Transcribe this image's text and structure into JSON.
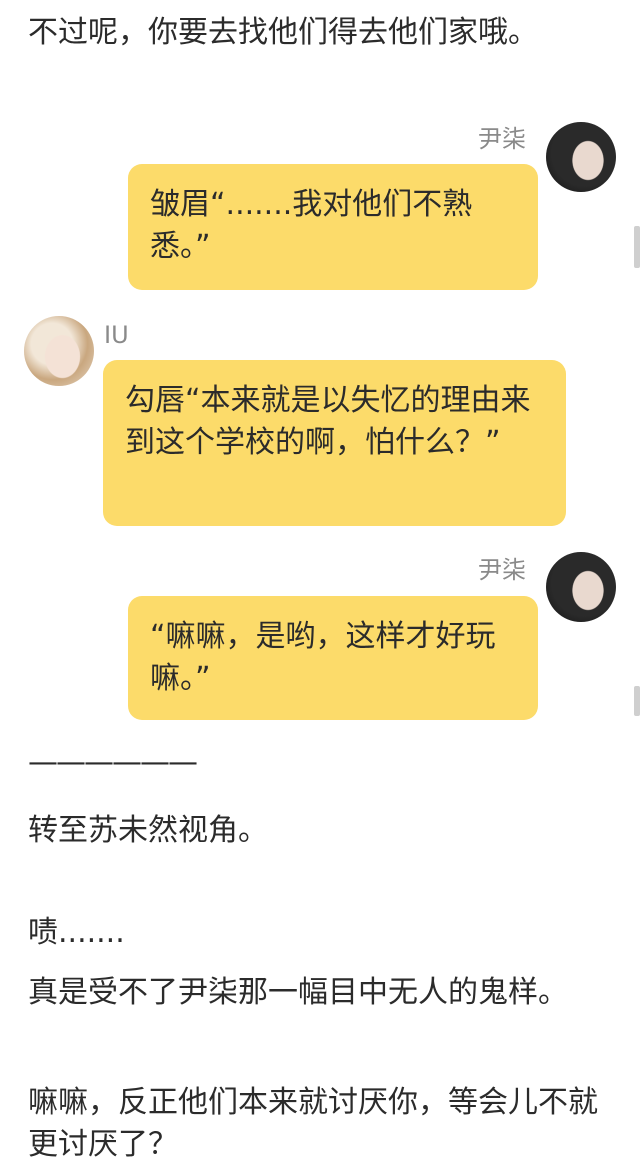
{
  "narration": {
    "top": "不过呢，你要去找他们得去他们家哦。",
    "divider": "——————",
    "switch": "转至苏未然视角。",
    "tsk": "啧.......",
    "line1": "真是受不了尹柒那一幅目中无人的鬼样。",
    "line2": "嘛嘛，反正他们本来就讨厌你，等会儿不就更讨厌了？"
  },
  "chat": [
    {
      "speaker": "尹柒",
      "side": "right",
      "text": "皱眉“.......我对他们不熟悉。”"
    },
    {
      "speaker": "IU",
      "side": "left",
      "text": "勾唇“本来就是以失忆的理由来到这个学校的啊，怕什么？”"
    },
    {
      "speaker": "尹柒",
      "side": "right",
      "text": "“嘛嘛，是哟，这样才好玩嘛。”"
    }
  ]
}
